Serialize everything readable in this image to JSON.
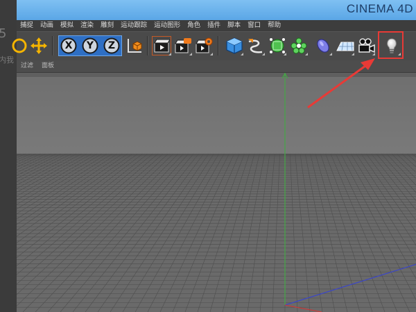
{
  "window": {
    "app_title": "CINEMA 4D"
  },
  "left_strip": {
    "ghost_top": "5",
    "ghost_mid": "内我"
  },
  "menu": {
    "items": [
      "捕捉",
      "动画",
      "模拟",
      "渲染",
      "雕刻",
      "运动跟踪",
      "运动图形",
      "角色",
      "插件",
      "脚本",
      "窗口",
      "帮助"
    ]
  },
  "toolbar": {
    "axis_labels": {
      "x": "X",
      "y": "Y",
      "z": "Z"
    },
    "tools": [
      {
        "name": "rotate-tool-icon"
      },
      {
        "name": "move-tool-icon"
      },
      {
        "name": "x-axis-lock-icon"
      },
      {
        "name": "y-axis-lock-icon"
      },
      {
        "name": "z-axis-lock-icon"
      },
      {
        "name": "coordinate-system-icon"
      },
      {
        "name": "render-view-icon"
      },
      {
        "name": "render-to-picture-viewer-icon"
      },
      {
        "name": "render-settings-icon"
      },
      {
        "name": "cube-primitive-icon"
      },
      {
        "name": "spline-pen-icon"
      },
      {
        "name": "subdivision-surface-icon"
      },
      {
        "name": "cloner-icon"
      },
      {
        "name": "deformer-icon"
      },
      {
        "name": "floor-icon"
      },
      {
        "name": "camera-icon"
      },
      {
        "name": "light-icon"
      }
    ]
  },
  "subbar": {
    "items": [
      "过滤",
      "面板"
    ]
  },
  "colors": {
    "title_bar": "#6ab3ec",
    "accent_blue": "#2e6fc4",
    "highlight_red": "#e83a36",
    "viewport_bg": "#8a8a8a",
    "y_axis": "#44a845",
    "x_axis": "#c43a3a",
    "z_axis": "#3b46c8"
  },
  "annotation": {
    "color": "#e83a36",
    "target": "light-icon"
  }
}
